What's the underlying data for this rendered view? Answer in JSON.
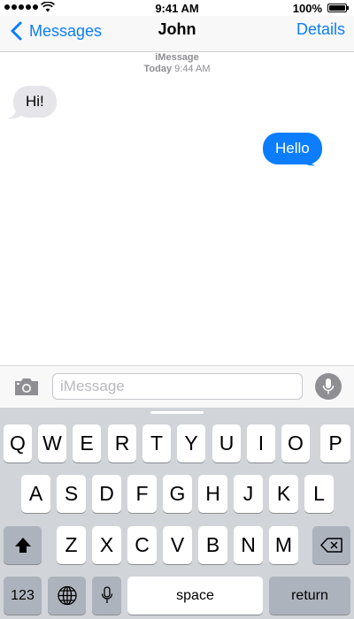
{
  "status_bar": {
    "time": "9:41 AM",
    "battery_percent": "100%",
    "signal_bars": 5
  },
  "nav": {
    "back_label": "Messages",
    "title": "John",
    "details_label": "Details"
  },
  "conversation": {
    "service_label": "iMessage",
    "timestamp_day": "Today",
    "timestamp_time": "9:44 AM",
    "messages": [
      {
        "direction": "incoming",
        "text": "Hi!"
      },
      {
        "direction": "outgoing",
        "text": "Hello"
      }
    ]
  },
  "input": {
    "placeholder": "iMessage",
    "value": ""
  },
  "keyboard": {
    "row1": [
      "Q",
      "W",
      "E",
      "R",
      "T",
      "Y",
      "U",
      "I",
      "O",
      "P"
    ],
    "row2": [
      "A",
      "S",
      "D",
      "F",
      "G",
      "H",
      "J",
      "K",
      "L"
    ],
    "row3": [
      "Z",
      "X",
      "C",
      "V",
      "B",
      "N",
      "M"
    ],
    "numbers_label": "123",
    "space_label": "space",
    "return_label": "return"
  },
  "colors": {
    "accent": "#0b7dfd",
    "incoming_bubble": "#e5e5ea",
    "keyboard_bg": "#d1d4d9",
    "modifier_key": "#adb3bc"
  }
}
